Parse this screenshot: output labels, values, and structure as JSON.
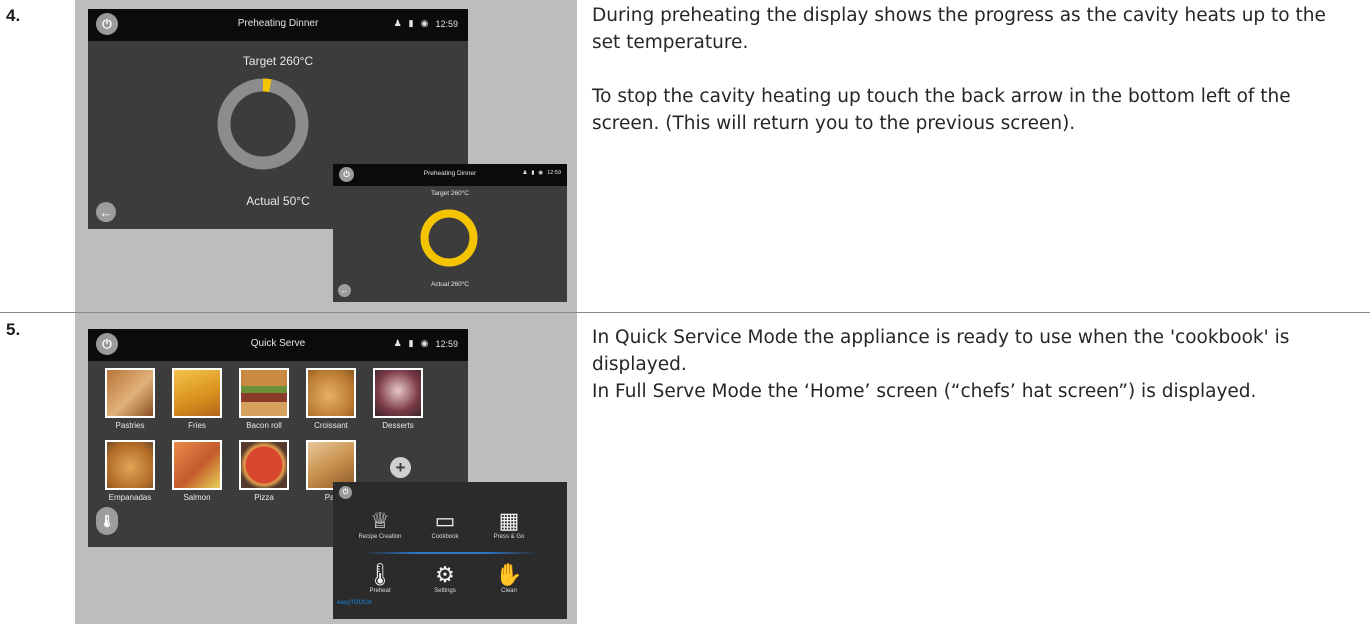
{
  "steps": [
    {
      "number": "4.",
      "paragraphs": [
        "During preheating the display shows the progress as the cavity heats up to the set temperature.",
        "To stop the cavity heating up touch the back arrow in the bottom left of the screen. (This will return you to the previous screen)."
      ],
      "screen_main": {
        "title": "Preheating Dinner",
        "time": "12:59",
        "target": "Target 260°C",
        "actual": "Actual 50°C",
        "progress_fraction": 0.03
      },
      "screen_inset": {
        "title": "Preheating Dinner",
        "time": "12:59",
        "target": "Target 260°C",
        "actual": "Actual 260°C",
        "progress_fraction": 1.0
      }
    },
    {
      "number": "5.",
      "paragraphs": [
        "In Quick Service Mode the appliance is ready to use when the 'cookbook' is displayed.",
        "In Full Serve Mode the ‘Home’ screen (“chefs’ hat screen”) is displayed."
      ],
      "screen_main": {
        "title": "Quick Serve",
        "time": "12:59",
        "tiles": [
          "Pastries",
          "Fries",
          "Bacon roll",
          "Croissant",
          "Desserts",
          "Empanadas",
          "Salmon",
          "Pizza",
          "Par"
        ]
      },
      "screen_inset": {
        "menu_items": [
          "Recipe Creation",
          "Cookbook",
          "Press & Go",
          "Preheat",
          "Settings",
          "Clean"
        ],
        "brand": "easyTOUCH"
      }
    }
  ],
  "colors": {
    "gauge_track": "#8c8c8c",
    "gauge_fill": "#f5c400",
    "screen_bg": "#3c3c3c",
    "brand": "#1f6fb5"
  }
}
